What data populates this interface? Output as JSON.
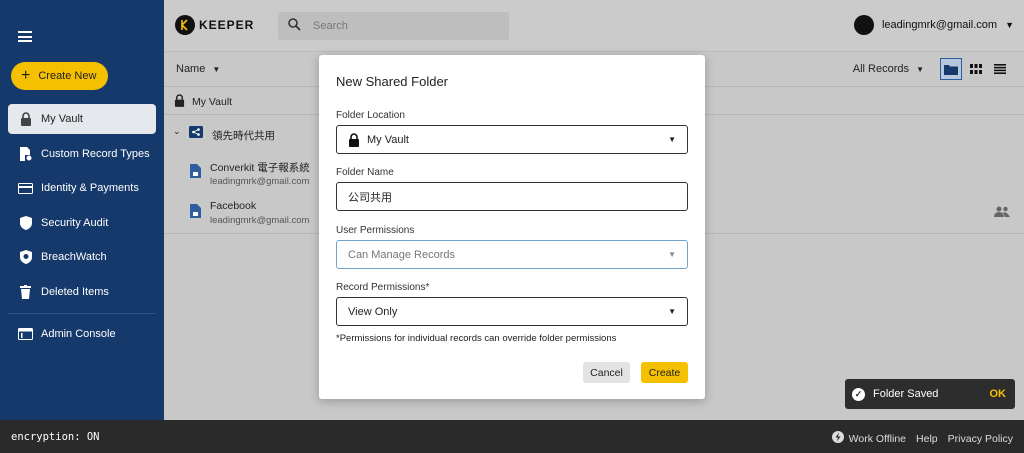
{
  "app": {
    "brand": "KEEPER",
    "search_placeholder": "Search",
    "account_email": "leadingmrk@gmail.com"
  },
  "sidebar": {
    "create_new_label": "Create New",
    "items": [
      {
        "label": "My Vault",
        "icon": "lock-icon",
        "active": true
      },
      {
        "label": "Custom Record Types",
        "icon": "doc-gear-icon"
      },
      {
        "label": "Identity & Payments",
        "icon": "card-icon"
      },
      {
        "label": "Security Audit",
        "icon": "shield-icon"
      },
      {
        "label": "BreachWatch",
        "icon": "breachwatch-icon"
      },
      {
        "label": "Deleted Items",
        "icon": "trash-icon"
      },
      {
        "label": "Admin Console",
        "icon": "console-icon"
      }
    ]
  },
  "toolbar": {
    "sort_label": "Name",
    "filter_label": "All Records"
  },
  "vault": {
    "root_label": "My Vault",
    "folder_label": "領先時代共用",
    "records": [
      {
        "title": "Converkit 電子報系統",
        "subtitle": "leadingmrk@gmail.com"
      },
      {
        "title": "Facebook",
        "subtitle": "leadingmrk@gmail.com"
      }
    ]
  },
  "modal": {
    "title": "New Shared Folder",
    "folder_location_label": "Folder Location",
    "folder_location_value": "My Vault",
    "folder_name_label": "Folder Name",
    "folder_name_value": "公司共用",
    "user_permissions_label": "User Permissions",
    "user_permissions_value": "Can Manage Records",
    "record_permissions_label": "Record Permissions*",
    "record_permissions_value": "View Only",
    "note": "*Permissions for individual records can override folder permissions",
    "cancel_label": "Cancel",
    "create_label": "Create"
  },
  "toast": {
    "message": "Folder Saved",
    "action": "OK"
  },
  "footer": {
    "encryption_status": "encryption: ON",
    "work_offline": "Work Offline",
    "help": "Help",
    "privacy": "Privacy Policy"
  },
  "colors": {
    "sidebar_bg": "#15396a",
    "accent_yellow": "#f5c000",
    "footer_bg": "#2a2a2a"
  }
}
